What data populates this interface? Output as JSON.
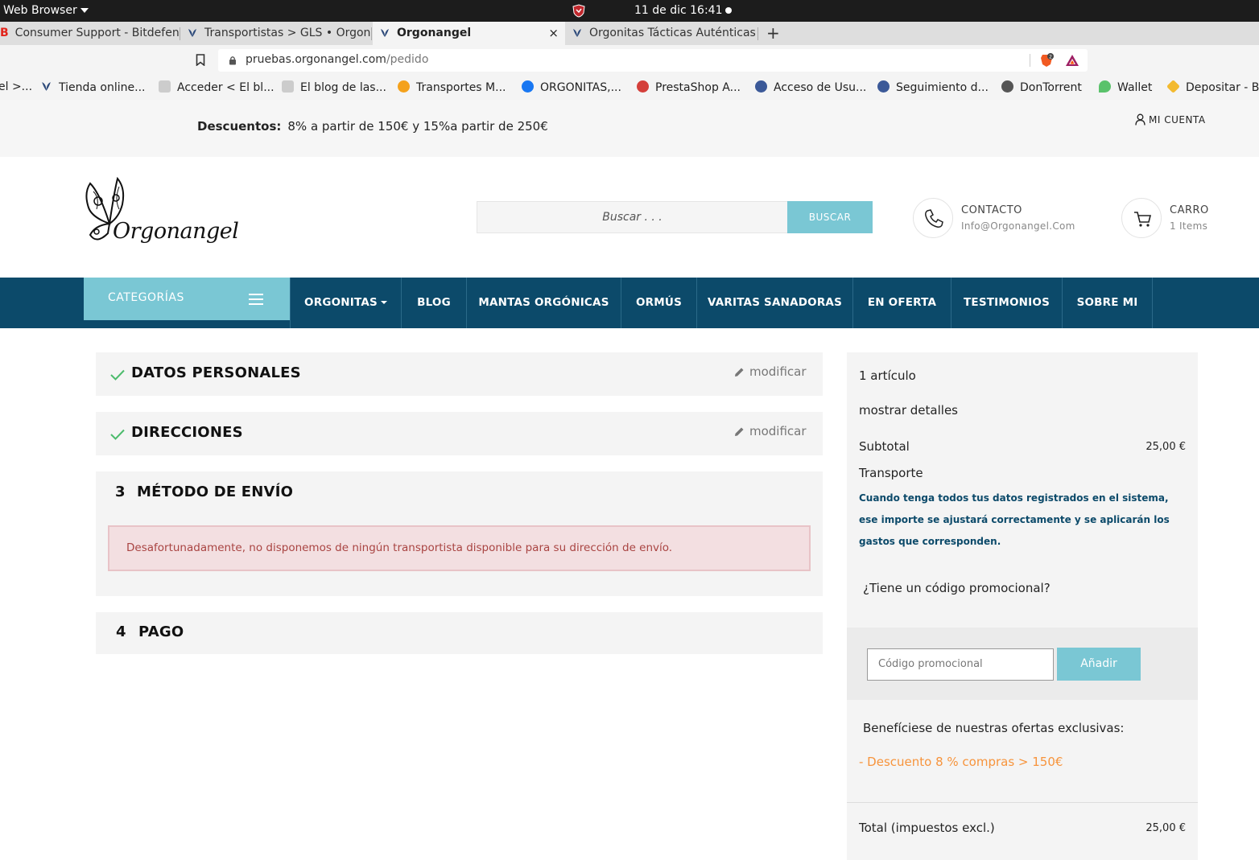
{
  "os": {
    "app_menu": "Web Browser",
    "clock": "11 de dic  16:41"
  },
  "tabs": [
    {
      "label": "Consumer Support - Bitdefender",
      "prefix": "B"
    },
    {
      "label": "Transportistas > GLS • Orgonangel"
    },
    {
      "label": "Orgonangel",
      "close": "×"
    },
    {
      "label": "Orgonitas Tácticas Auténticas"
    }
  ],
  "new_tab": "+",
  "address": {
    "host": "pruebas.orgonangel.com",
    "path": "/pedido"
  },
  "bookmarks": [
    {
      "label": "el >...",
      "color": "#f4f4f4"
    },
    {
      "label": "Tienda online...",
      "color": "#2d4a7a"
    },
    {
      "label": "Acceder < El bl...",
      "color": "#bbbbbb"
    },
    {
      "label": "El blog de las...",
      "color": "#bbbbbb"
    },
    {
      "label": "Transportes M...",
      "color": "#f4a11b"
    },
    {
      "label": "ORGONITAS,...",
      "color": "#1877f2"
    },
    {
      "label": "PrestaShop A...",
      "color": "#d43f3a"
    },
    {
      "label": "Acceso de Usu...",
      "color": "#3b5998"
    },
    {
      "label": "Seguimiento d...",
      "color": "#3b5998"
    },
    {
      "label": "DonTorrent",
      "color": "#555555"
    },
    {
      "label": "Wallet",
      "color": "#5ac26b"
    },
    {
      "label": "Depositar - Bi",
      "color": "#f3ba2f"
    }
  ],
  "site": {
    "discount_label": "Descuentos:",
    "discount_text": "8% a partir de 150€ y 15%a partir de 250€",
    "account": "MI CUENTA",
    "logo_text": "Orgonangel",
    "search_placeholder": "Buscar . . .",
    "search_button": "BUSCAR",
    "contact_title": "CONTACTO",
    "contact_sub": "Info@Orgonangel.Com",
    "cart_title": "CARRO",
    "cart_sub": "1 Items"
  },
  "nav": {
    "categories": "CATEGORÍAS",
    "items": [
      "ORGONITAS",
      "BLOG",
      "MANTAS ORGÓNICAS",
      "ORMÚS",
      "VARITAS SANADORAS",
      "EN OFERTA",
      "TESTIMONIOS",
      "SOBRE MI"
    ]
  },
  "steps": {
    "personal": {
      "title": "DATOS PERSONALES",
      "edit": "modificar"
    },
    "addresses": {
      "title": "DIRECCIONES",
      "edit": "modificar"
    },
    "shipping": {
      "num": "3",
      "title": "MÉTODO DE ENVÍO",
      "alert": "Desafortunadamente, no disponemos de ningún transportista disponible para su dirección de envío."
    },
    "payment": {
      "num": "4",
      "title": "PAGO"
    }
  },
  "summary": {
    "items": "1 artículo",
    "details": "mostrar detalles",
    "subtotal_label": "Subtotal",
    "subtotal_value": "25,00 €",
    "shipping_label": "Transporte",
    "shipping_note": "Cuando tenga todos tus datos registrados en el sistema, ese importe se ajustará correctamente y se aplicarán los gastos que corresponden.",
    "promo_question": "¿Tiene un código promocional?",
    "promo_placeholder": "Código promocional",
    "promo_button": "Añadir",
    "offers_title": "Benefíciese de nuestras ofertas exclusivas:",
    "offer_item": "- Descuento 8 % compras > 150€",
    "total_label": "Total (impuestos excl.)",
    "total_value": "25,00 €"
  },
  "colors": {
    "nav": "#0c4a6a",
    "accent": "#7ac7d4",
    "offer": "#f7943c",
    "alert_text": "#a94442"
  }
}
